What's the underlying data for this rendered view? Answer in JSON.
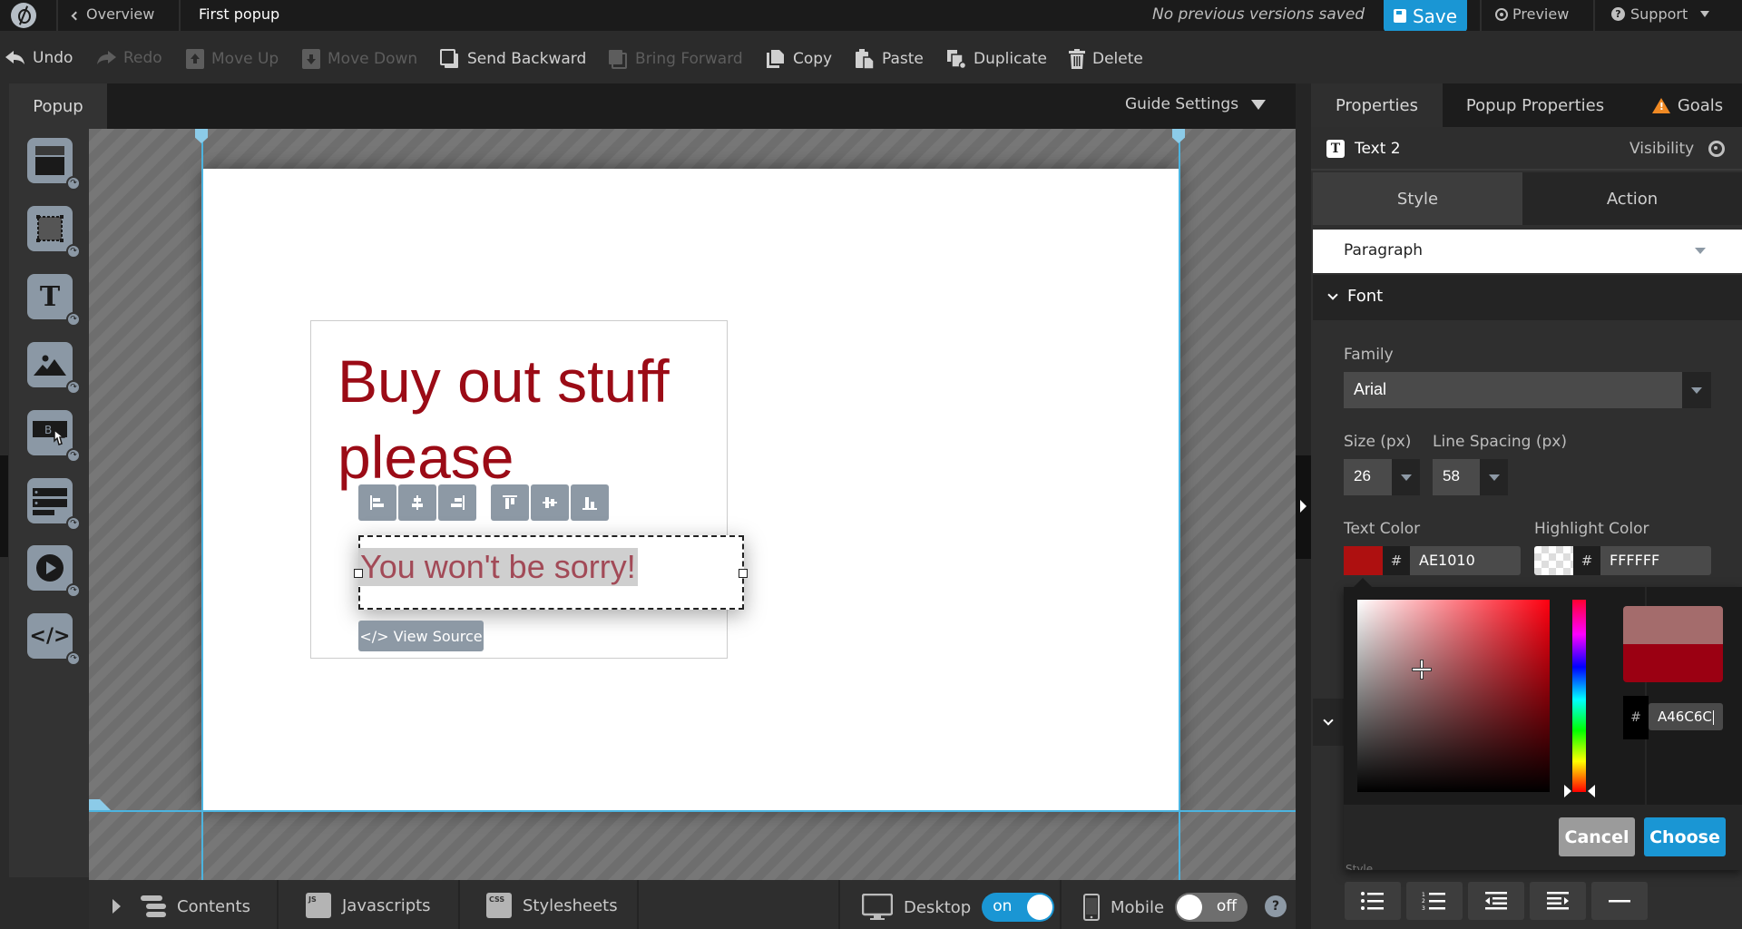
{
  "topbar": {
    "overview_label": "Overview",
    "page_title": "First popup",
    "versions_status": "No previous versions saved",
    "save_label": "Save",
    "preview_label": "Preview",
    "support_label": "Support"
  },
  "toolbar": {
    "undo": "Undo",
    "redo": "Redo",
    "move_up": "Move Up",
    "move_down": "Move Down",
    "send_backward": "Send Backward",
    "bring_forward": "Bring Forward",
    "copy": "Copy",
    "paste": "Paste",
    "duplicate": "Duplicate",
    "delete": "Delete"
  },
  "left_panel": {
    "tab_label": "Popup",
    "tools": [
      {
        "name": "container-tool",
        "icon": "container-icon"
      },
      {
        "name": "box-tool",
        "icon": "box-icon"
      },
      {
        "name": "text-tool",
        "icon": "text-icon",
        "glyph": "T"
      },
      {
        "name": "image-tool",
        "icon": "image-icon"
      },
      {
        "name": "button-tool",
        "icon": "button-icon",
        "glyph": "B"
      },
      {
        "name": "form-tool",
        "icon": "form-icon"
      },
      {
        "name": "video-tool",
        "icon": "video-icon"
      },
      {
        "name": "html-tool",
        "icon": "code-icon",
        "glyph": "</>"
      }
    ]
  },
  "canvas": {
    "guide_settings_label": "Guide Settings",
    "heading": "Buy out stuff please",
    "selected_text": "You won't be sorry!",
    "view_source_label": "</> View Source",
    "heading_color": "#9B0B16",
    "selected_text_color": "#A24A57"
  },
  "bottombar": {
    "contents_label": "Contents",
    "javascripts_label": "Javascripts",
    "js_badge": "JS",
    "stylesheets_label": "Stylesheets",
    "css_badge": "CSS",
    "desktop_label": "Desktop",
    "desktop_toggle": "on",
    "mobile_label": "Mobile",
    "mobile_toggle": "off",
    "help_glyph": "?"
  },
  "properties": {
    "tabs": [
      "Properties",
      "Popup Properties",
      "Goals"
    ],
    "active_tab": "Properties",
    "element_icon_glyph": "T",
    "element_name": "Text 2",
    "visibility_label": "Visibility",
    "subtabs": [
      "Style",
      "Action"
    ],
    "active_subtab": "Style",
    "text_type": "Paragraph",
    "font_section_label": "Font",
    "family_label": "Family",
    "family_value": "Arial",
    "size_label": "Size (px)",
    "size_value": "26",
    "line_spacing_label": "Line Spacing (px)",
    "line_spacing_value": "58",
    "text_color_label": "Text Color",
    "text_color_hex": "AE1010",
    "text_color_swatch": "#AE1010",
    "highlight_color_label": "Highlight Color",
    "highlight_color_hex": "FFFFFF",
    "hash": "#",
    "style_label_peek": "Style"
  },
  "color_picker": {
    "new_color": "#A46C6C",
    "current_color": "#9B0012",
    "hex_value": "A46C6C",
    "hue_color": "#FF0010",
    "cancel_label": "Cancel",
    "choose_label": "Choose"
  },
  "list_buttons": [
    {
      "name": "bulleted-list",
      "icon": "bullet-list-icon"
    },
    {
      "name": "numbered-list",
      "icon": "numbered-list-icon"
    },
    {
      "name": "outdent",
      "icon": "outdent-icon"
    },
    {
      "name": "indent",
      "icon": "indent-icon"
    },
    {
      "name": "horizontal-rule",
      "icon": "horizontal-rule-icon"
    }
  ]
}
